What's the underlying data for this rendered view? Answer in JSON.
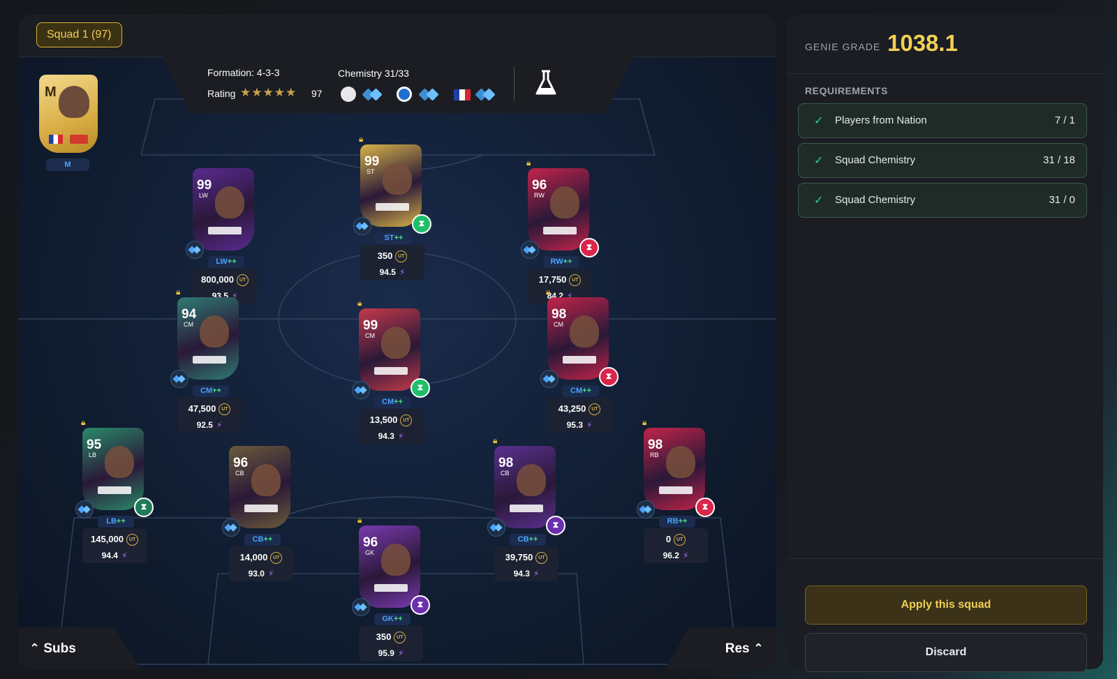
{
  "squad": {
    "label": "Squad 1 (97)"
  },
  "info": {
    "formation_label": "Formation: 4-3-3",
    "chemistry_label": "Chemistry 31/33",
    "rating_label": "Rating",
    "rating_stars": "★★★★★",
    "rating_value": "97"
  },
  "manager": {
    "letter": "M",
    "position": "M"
  },
  "players": [
    {
      "rating": "99",
      "pos": "LW",
      "tag": "LW",
      "price": "800,000",
      "grade": "93.5",
      "locked": false,
      "card_color": "#5a2a90",
      "evo": false
    },
    {
      "rating": "99",
      "pos": "ST",
      "tag": "ST",
      "price": "350",
      "grade": "94.5",
      "locked": true,
      "card_color": "#d8b349",
      "evo": true,
      "evo_color": "#1fbf6a"
    },
    {
      "rating": "96",
      "pos": "RW",
      "tag": "RW",
      "price": "17,750",
      "grade": "84.2",
      "locked": true,
      "card_color": "#c2244a",
      "evo": true,
      "evo_color": "#d9264a"
    },
    {
      "rating": "94",
      "pos": "CM",
      "tag": "CM",
      "price": "47,500",
      "grade": "92.5",
      "locked": true,
      "card_color": "#2f7b73",
      "evo": false
    },
    {
      "rating": "99",
      "pos": "CM",
      "tag": "CM",
      "price": "13,500",
      "grade": "94.3",
      "locked": true,
      "card_color": "#c43a4a",
      "evo": true,
      "evo_color": "#1fbf6a"
    },
    {
      "rating": "98",
      "pos": "CM",
      "tag": "CM",
      "price": "43,250",
      "grade": "95.3",
      "locked": true,
      "card_color": "#c2244a",
      "evo": true,
      "evo_color": "#d9264a"
    },
    {
      "rating": "95",
      "pos": "LB",
      "tag": "LB",
      "price": "145,000",
      "grade": "94.4",
      "locked": true,
      "card_color": "#2a8a6a",
      "evo": true,
      "evo_color": "#1f7a5a"
    },
    {
      "rating": "96",
      "pos": "CB",
      "tag": "CB",
      "price": "14,000",
      "grade": "93.0",
      "locked": false,
      "card_color": "#6a5a3a",
      "evo": false
    },
    {
      "rating": "96",
      "pos": "GK",
      "tag": "GK",
      "price": "350",
      "grade": "95.9",
      "locked": true,
      "card_color": "#7a3ab0",
      "evo": true,
      "evo_color": "#6b2fb0"
    },
    {
      "rating": "98",
      "pos": "CB",
      "tag": "CB",
      "price": "39,750",
      "grade": "94.3",
      "locked": true,
      "card_color": "#5a3090",
      "evo": true,
      "evo_color": "#6b2fb0"
    },
    {
      "rating": "98",
      "pos": "RB",
      "tag": "RB",
      "price": "0",
      "grade": "96.2",
      "locked": true,
      "card_color": "#c2244a",
      "evo": true,
      "evo_color": "#d9264a"
    }
  ],
  "tag_suffix": "++",
  "coin_label": "UT",
  "bottom": {
    "subs": "Subs",
    "res": "Res"
  },
  "right": {
    "genie_label": "GENIE GRADE",
    "genie_value": "1038.1",
    "requirements_title": "REQUIREMENTS",
    "requirements": [
      {
        "label": "Players from Nation",
        "value": "7 / 1"
      },
      {
        "label": "Squad Chemistry",
        "value": "31 / 18"
      },
      {
        "label": "Squad Chemistry",
        "value": "31 / 0"
      }
    ],
    "apply_label": "Apply this squad",
    "discard_label": "Discard"
  },
  "colors": {
    "accent_gold": "#f2cf55",
    "check_green": "#3ccf7e",
    "chem_blue": "#4aa3ff"
  }
}
